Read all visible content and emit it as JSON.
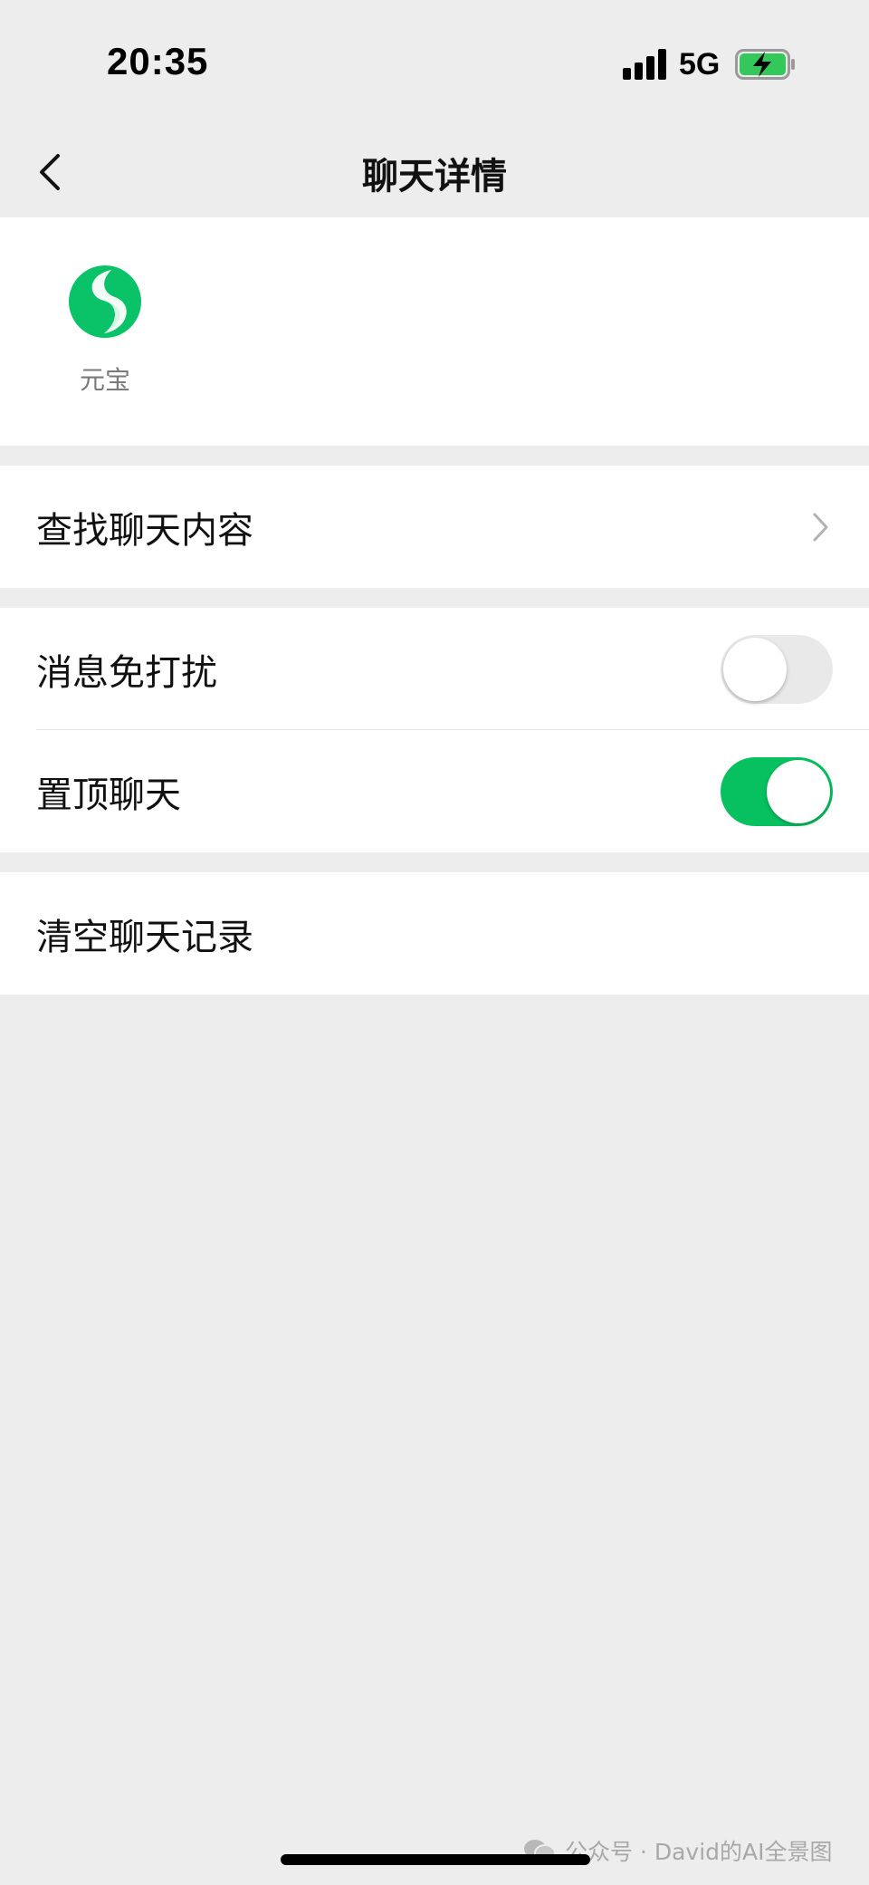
{
  "status_bar": {
    "time": "20:35",
    "network": "5G",
    "signal_icon": "cellular-signal-icon",
    "battery_icon": "battery-charging-icon"
  },
  "nav": {
    "title": "聊天详情",
    "back_icon": "chevron-left-icon"
  },
  "members": [
    {
      "name": "元宝",
      "avatar_icon": "yuanbao-logo-icon"
    }
  ],
  "cells": {
    "search_chat": "查找聊天内容",
    "mute_notifications": "消息免打扰",
    "pin_chat": "置顶聊天",
    "clear_history": "清空聊天记录"
  },
  "toggles": {
    "mute_notifications": false,
    "pin_chat": true
  },
  "watermark": "公众号 · David的AI全景图",
  "colors": {
    "accent": "#07c160",
    "background": "#ededed",
    "card": "#ffffff"
  }
}
